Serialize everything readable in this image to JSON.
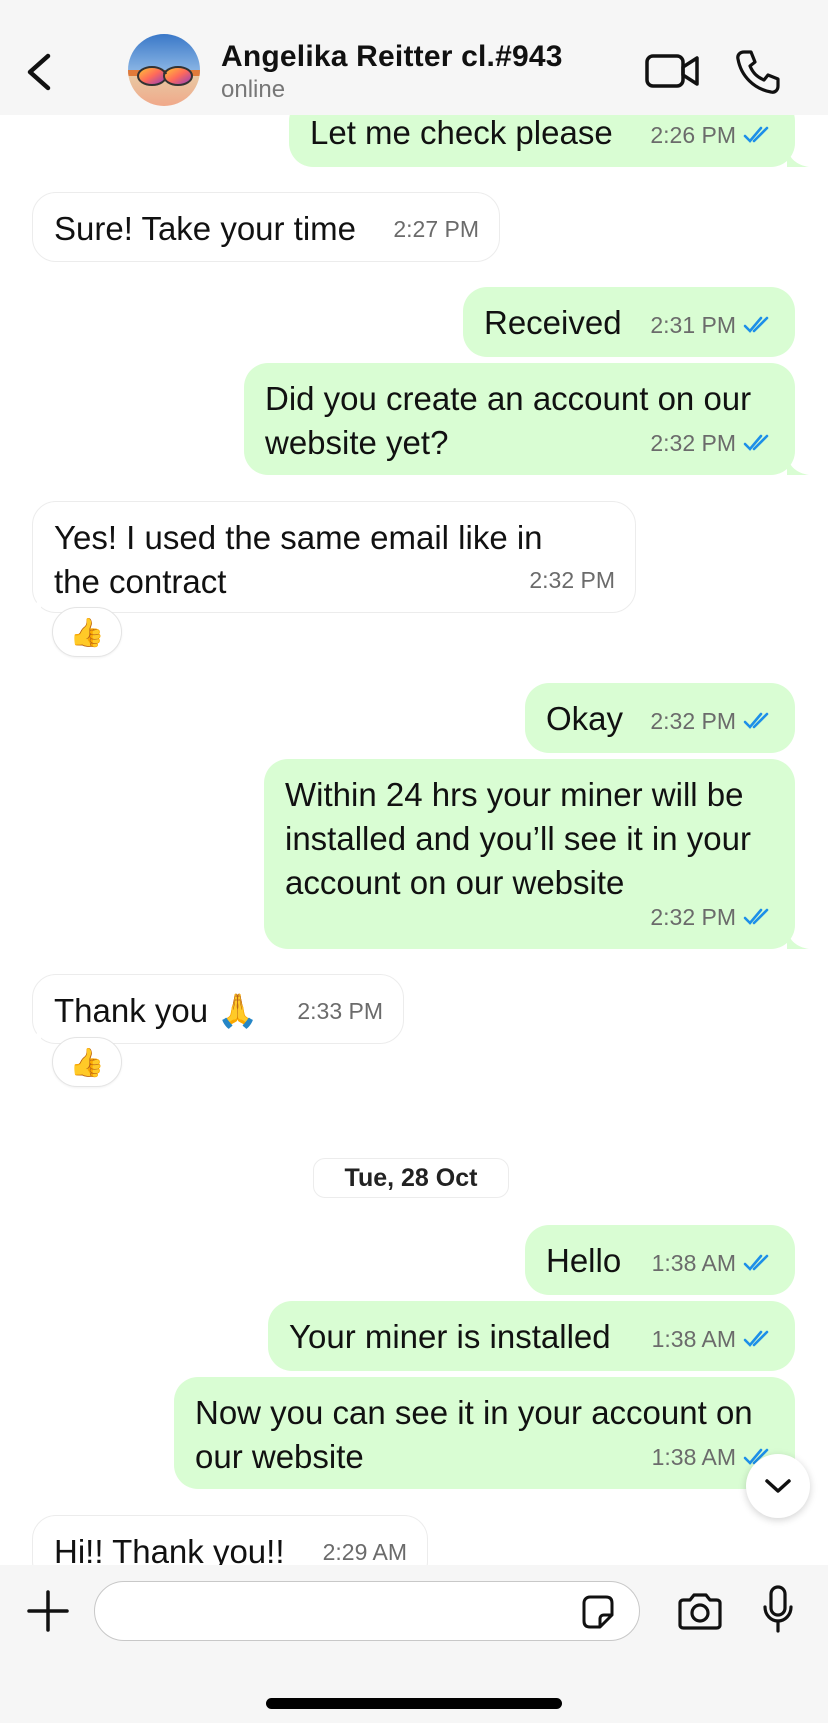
{
  "header": {
    "contact_name": "Angelika Reitter cl.#943",
    "status": "online"
  },
  "messages": [
    {
      "direction": "out",
      "text": "Let me check please",
      "time": "2:26 PM",
      "status": "read"
    },
    {
      "direction": "in",
      "text": "Sure! Take your time",
      "time": "2:27 PM"
    },
    {
      "direction": "out",
      "text": "Received",
      "time": "2:31 PM",
      "status": "read"
    },
    {
      "direction": "out",
      "text": "Did you create an account on our website yet?",
      "time": "2:32 PM",
      "status": "read"
    },
    {
      "direction": "in",
      "text": "Yes! I used the same email like in the contract",
      "time": "2:32 PM",
      "reaction": "👍"
    },
    {
      "direction": "out",
      "text": "Okay",
      "time": "2:32 PM",
      "status": "read"
    },
    {
      "direction": "out",
      "text": "Within 24 hrs your miner will be installed and you’ll see it in your account on our website",
      "time": "2:32 PM",
      "status": "read"
    },
    {
      "direction": "in",
      "text": "Thank you 🙏",
      "time": "2:33 PM",
      "reaction": "👍"
    },
    {
      "direction": "out",
      "text": "Hello",
      "time": "1:38 AM",
      "status": "read"
    },
    {
      "direction": "out",
      "text": "Your miner is installed",
      "time": "1:38 AM",
      "status": "read"
    },
    {
      "direction": "out",
      "text": "Now you can see it in your account on our website",
      "time": "1:38 AM",
      "status": "read"
    },
    {
      "direction": "in",
      "text": "Hi!! Thank you!!",
      "time": "2:29 AM"
    }
  ],
  "date_separator": "Tue, 28 Oct",
  "composer": {
    "value": "",
    "placeholder": ""
  },
  "icons": {
    "back": "chevron-left-icon",
    "video": "video-camera-icon",
    "call": "phone-icon",
    "plus": "plus-icon",
    "sticker": "sticker-icon",
    "camera": "camera-icon",
    "mic": "microphone-icon",
    "scroll_down": "chevron-down-icon",
    "read_receipt": "double-check-icon"
  },
  "colors": {
    "outgoing_bubble": "#d9fdd3",
    "incoming_bubble": "#ffffff",
    "read_tick": "#1d8fe8",
    "bar_background": "#f6f6f6"
  }
}
